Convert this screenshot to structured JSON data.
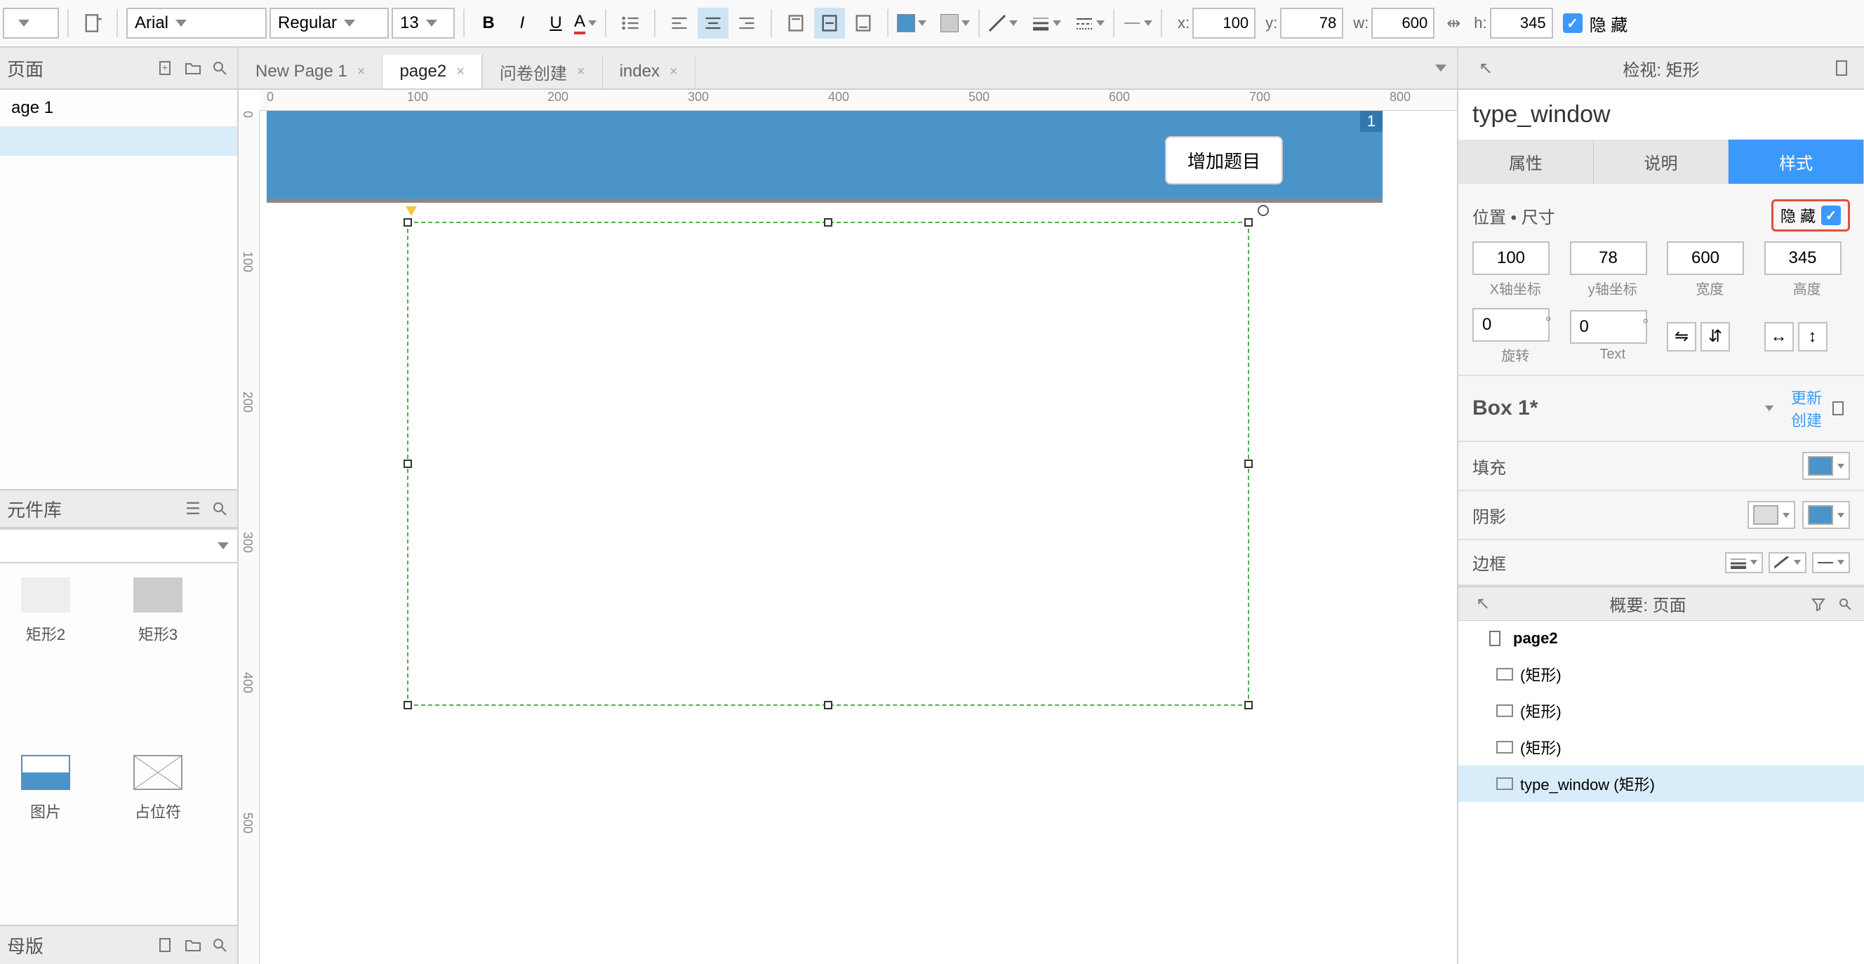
{
  "toolbar": {
    "font_family": "Arial",
    "font_weight": "Regular",
    "font_size": "13",
    "x_label": "x:",
    "x_val": "100",
    "y_label": "y:",
    "y_val": "78",
    "w_label": "w:",
    "w_val": "600",
    "h_label": "h:",
    "h_val": "345",
    "hidden_label": "隐 藏"
  },
  "left": {
    "pages_title": "页面",
    "page_items": [
      "age 1",
      ""
    ],
    "lib_title": "元件库",
    "widgets": [
      {
        "label": "矩形2"
      },
      {
        "label": "矩形3"
      },
      {
        "label": "图片"
      },
      {
        "label": "占位符"
      }
    ],
    "masters_title": "母版"
  },
  "tabs": [
    {
      "label": "New Page 1",
      "active": false
    },
    {
      "label": "page2",
      "active": true
    },
    {
      "label": "问卷创建",
      "active": false
    },
    {
      "label": "index",
      "active": false
    }
  ],
  "canvas": {
    "ruler_h": [
      "0",
      "100",
      "200",
      "300",
      "400",
      "500",
      "600",
      "700",
      "800"
    ],
    "ruler_v": [
      "0",
      "100",
      "200",
      "300",
      "400",
      "500"
    ],
    "blue_bar_badge": "1",
    "add_button": "增加题目"
  },
  "inspector": {
    "header_title": "检视: 矩形",
    "widget_name": "type_window",
    "tabs": [
      "属性",
      "说明",
      "样式"
    ],
    "active_tab": 2,
    "pos_title": "位置 • 尺寸",
    "hidden_label": "隐 藏",
    "x": "100",
    "y": "78",
    "w": "600",
    "h": "345",
    "x_lbl": "X轴坐标",
    "y_lbl": "y轴坐标",
    "w_lbl": "宽度",
    "h_lbl": "高度",
    "rot": "0",
    "text_rot": "0",
    "rot_lbl": "旋转",
    "text_lbl": "Text",
    "box_style": "Box 1*",
    "update": "更新",
    "create": "创建",
    "fill": "填充",
    "shadow": "阴影",
    "border": "边框",
    "fill_color": "#4a94c9",
    "shadow_in": "#cccccc",
    "shadow_out": "#4a94c9"
  },
  "outline": {
    "title": "概要: 页面",
    "root": "page2",
    "items": [
      {
        "label": "(矩形)"
      },
      {
        "label": "(矩形)"
      },
      {
        "label": "(矩形)"
      },
      {
        "label": "type_window (矩形)",
        "sel": true
      }
    ]
  }
}
